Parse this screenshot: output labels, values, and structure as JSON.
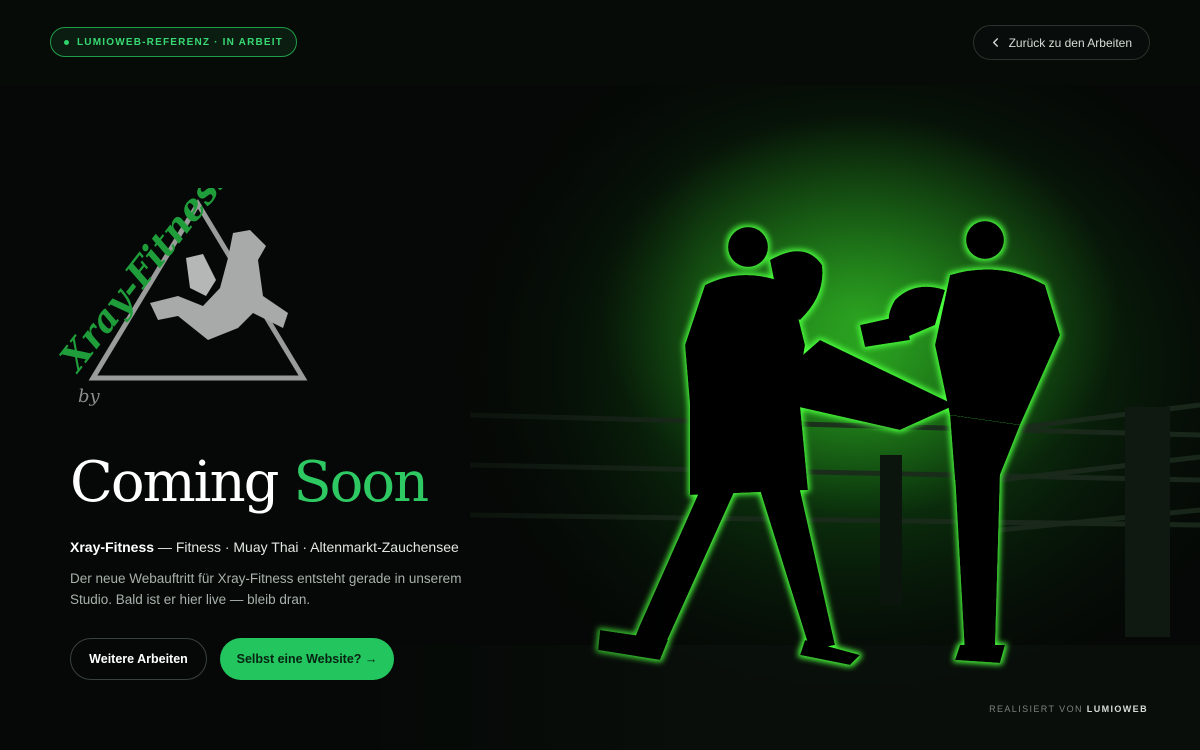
{
  "header": {
    "badge_label": "LUMIOWEB-REFERENZ · IN ARBEIT",
    "back_label": "Zurück zu den Arbeiten"
  },
  "logo": {
    "brand_text": "Xray-Fitness",
    "tagline": "by"
  },
  "hero": {
    "headline_white": "Coming",
    "headline_green": "Soon",
    "subtitle_brand": "Xray-Fitness",
    "subtitle_rest": " — Fitness · Muay Thai · Altenmarkt-Zauchensee",
    "description": "Der neue Webauftritt für Xray-Fitness entsteht gerade in unserem Studio. Bald ist er hier live — bleib dran.",
    "button_secondary": "Weitere Arbeiten",
    "button_primary": "Selbst eine Website? →"
  },
  "footer": {
    "prefix": "REALISIERT VON ",
    "brand": "LUMIOWEB"
  },
  "colors": {
    "accent": "#22c55e",
    "background": "#050806",
    "glow": "#39ff3a"
  },
  "icons": {
    "back": "chevron-left-icon",
    "status_dot": "status-dot-icon"
  }
}
